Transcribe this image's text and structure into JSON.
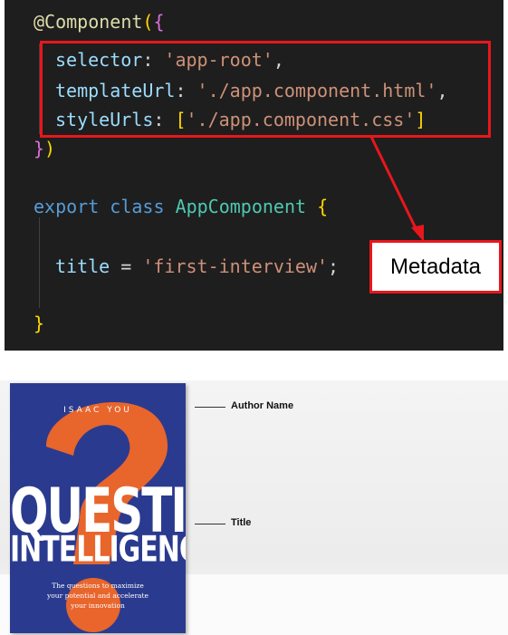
{
  "code": {
    "line1": {
      "decorator": "@Component",
      "open_paren": "(",
      "open_brace": "{"
    },
    "line2": {
      "key": "selector",
      "colon": ": ",
      "value": "'app-root'",
      "comma": ","
    },
    "line3": {
      "key": "templateUrl",
      "colon": ": ",
      "value": "'./app.component.html'",
      "comma": ","
    },
    "line4": {
      "key": "styleUrls",
      "colon": ": ",
      "open": "[",
      "value": "'./app.component.css'",
      "close": "]"
    },
    "line5": {
      "close_brace": "}",
      "close_paren": ")"
    },
    "line6": {
      "kw1": "export",
      "kw2": "class",
      "name": "AppComponent",
      "open_brace": "{"
    },
    "line7": {
      "prop": "title",
      "eq": " = ",
      "value": "'first-interview'",
      "semi": ";"
    },
    "line8": {
      "close_brace": "}"
    }
  },
  "annotation": {
    "label": "Metadata"
  },
  "book": {
    "author": "ISAAC YOU",
    "title_line1": "QUESTION",
    "title_line2": "INTELLIGENCE",
    "blurb": "The questions to maximize your potential and accelerate your innovation"
  },
  "callouts": {
    "author_label": "Author Name",
    "title_label": "Title"
  },
  "colors": {
    "annotation_red": "#e8171b",
    "book_blue": "#2a3b8f",
    "book_orange": "#e8652c",
    "editor_bg": "#1e1e1e"
  }
}
